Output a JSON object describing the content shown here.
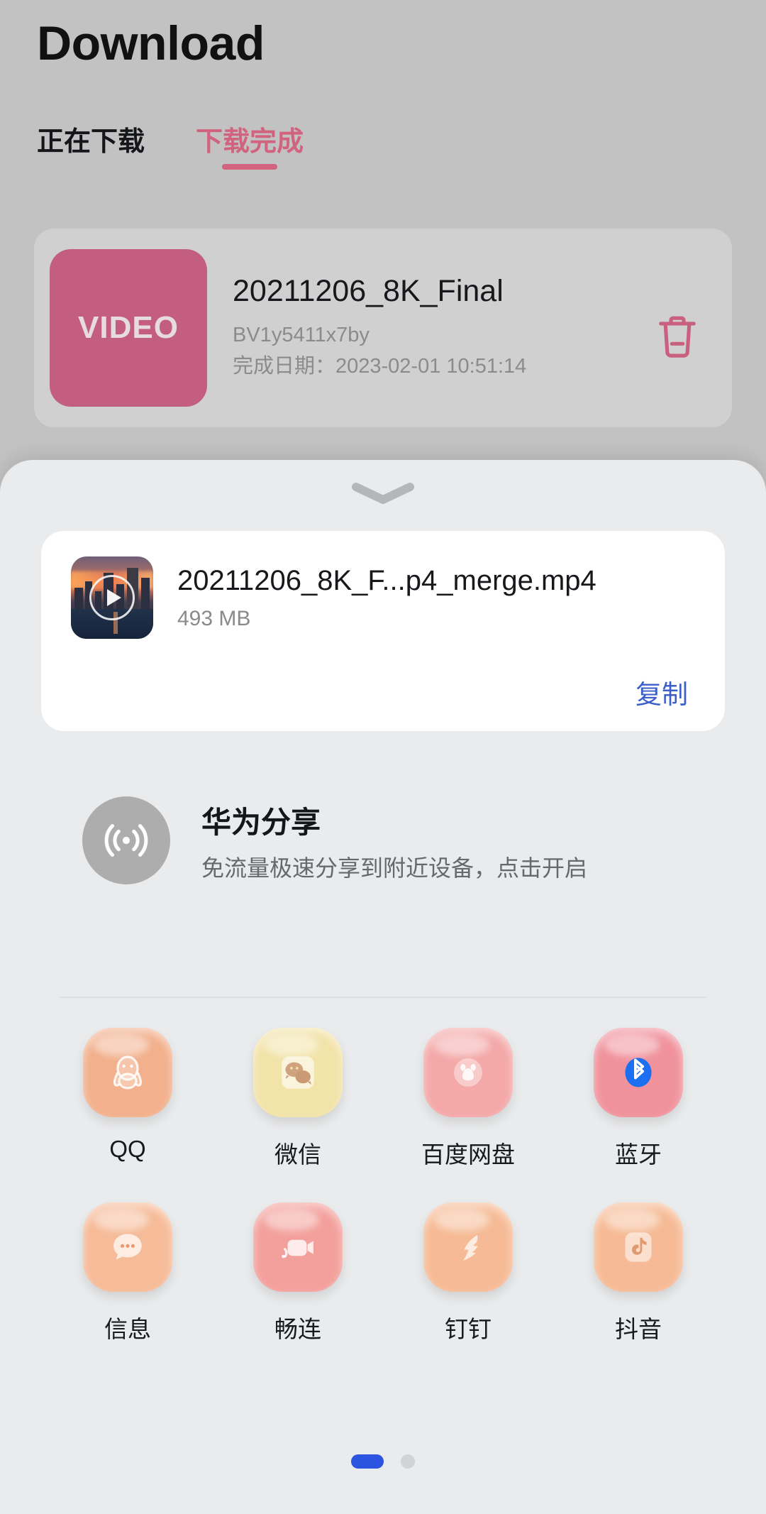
{
  "header": {
    "title": "Download"
  },
  "tabs": [
    {
      "label": "正在下载",
      "active": false
    },
    {
      "label": "下载完成",
      "active": true
    }
  ],
  "download_item": {
    "thumb_label": "VIDEO",
    "name": "20211206_8K_Final",
    "bv_id": "BV1y5411x7by",
    "completed_line": "完成日期：2023-02-01 10:51:14",
    "delete_icon": "trash-icon",
    "accent_color": "#c35e80"
  },
  "share_sheet": {
    "handle_icon": "chevron-down-icon",
    "file": {
      "name": "20211206_8K_F...p4_merge.mp4",
      "size": "493 MB",
      "thumbnail_icon": "video-play-thumbnail",
      "copy_label": "复制",
      "copy_color": "#3b5ecb"
    },
    "huawei_share": {
      "icon": "huawei-share-waves-icon",
      "title": "华为分享",
      "subtitle": "免流量极速分享到附近设备，点击开启"
    },
    "apps": [
      {
        "label": "QQ",
        "icon": "qq-penguin-icon",
        "bg": "#f2b08c"
      },
      {
        "label": "微信",
        "icon": "wechat-icon",
        "bg": "#f2e3a8"
      },
      {
        "label": "百度网盘",
        "icon": "baidu-netdisk-icon",
        "bg": "#f4a8a8"
      },
      {
        "label": "蓝牙",
        "icon": "bluetooth-icon",
        "bg": "#f0929c"
      },
      {
        "label": "信息",
        "icon": "messages-icon",
        "bg": "#f6bb98"
      },
      {
        "label": "畅连",
        "icon": "meetime-icon",
        "bg": "#f3a09c"
      },
      {
        "label": "钉钉",
        "icon": "dingtalk-icon",
        "bg": "#f6bb96"
      },
      {
        "label": "抖音",
        "icon": "douyin-icon",
        "bg": "#f6bb96"
      }
    ],
    "pagination": {
      "total": 2,
      "current": 1,
      "active_color": "#2b54e0"
    }
  }
}
